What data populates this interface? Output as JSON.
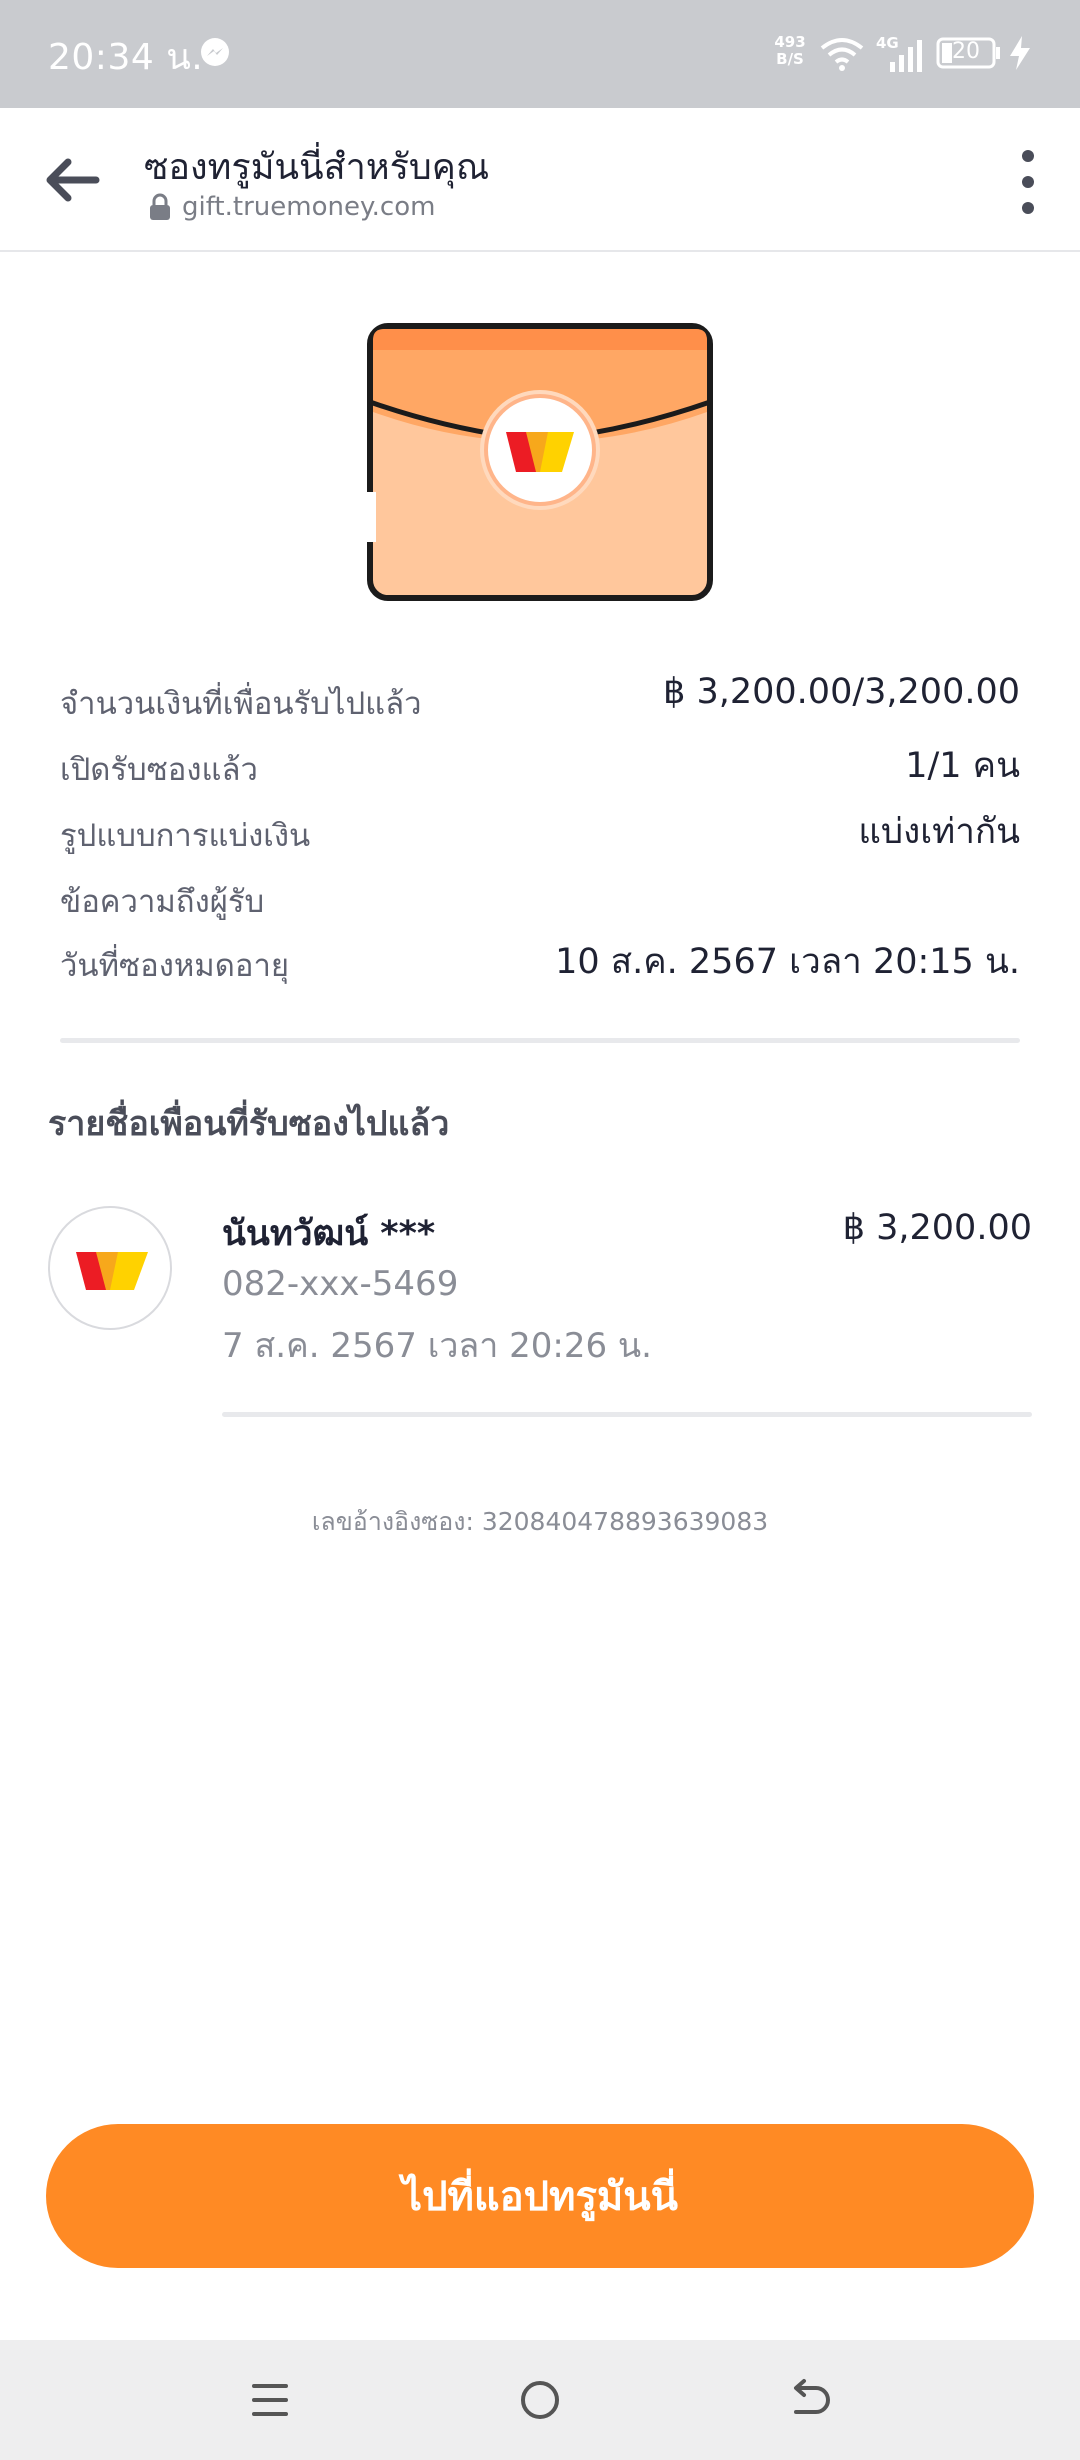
{
  "status_bar": {
    "time": "20:34 น.",
    "speed_value": "493",
    "speed_unit": "B/S",
    "network": "4G",
    "battery": "20"
  },
  "app_bar": {
    "title": "ซองทรูมันนี่สำหรับคุณ",
    "url": "gift.truemoney.com"
  },
  "info": {
    "rows": [
      {
        "label": "จำนวนเงินที่เพื่อนรับไปแล้ว",
        "value": "฿ 3,200.00/3,200.00"
      },
      {
        "label": "เปิดรับซองแล้ว",
        "value": "1/1 คน"
      },
      {
        "label": "รูปแบบการแบ่งเงิน",
        "value": "แบ่งเท่ากัน"
      },
      {
        "label": "ข้อความถึงผู้รับ",
        "value": ""
      },
      {
        "label": "วันที่ซองหมดอายุ",
        "value": "10 ส.ค. 2567 เวลา 20:15 น."
      }
    ]
  },
  "receivers": {
    "title": "รายชื่อเพื่อนที่รับซองไปแล้ว",
    "items": [
      {
        "name": "นันทวัฒน์ ***",
        "phone": "082-xxx-5469",
        "date": "7 ส.ค. 2567 เวลา 20:26 น.",
        "amount": "฿ 3,200.00"
      }
    ]
  },
  "reference": "เลขอ้างอิงซอง: 320840478893639083",
  "cta": {
    "label": "ไปที่แอปทรูมันนี่"
  },
  "colors": {
    "accent": "#ff8a24",
    "envelope": "#ffc79c",
    "envelope_flap": "#ffa764"
  }
}
